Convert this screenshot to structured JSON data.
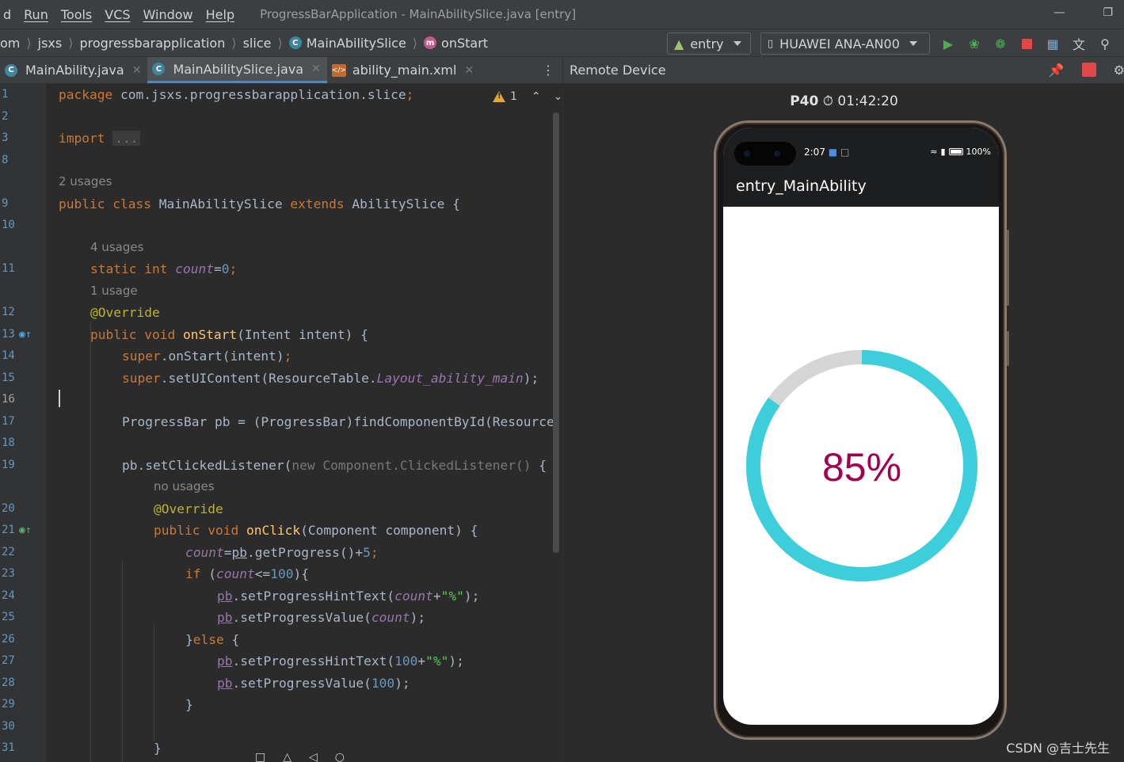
{
  "menubar": {
    "items": [
      "d",
      "Run",
      "Tools",
      "VCS",
      "Window",
      "Help"
    ],
    "title": "ProgressBarApplication - MainAbilitySlice.java [entry]"
  },
  "breadcrumb": {
    "items": [
      "om",
      "jsxs",
      "progressbarapplication",
      "slice",
      "MainAbilitySlice",
      "onStart"
    ]
  },
  "toolbar": {
    "module": "entry",
    "device": "HUAWEI ANA-AN00"
  },
  "tabs": [
    {
      "label": "MainAbility.java",
      "icon": "class-icon"
    },
    {
      "label": "MainAbilitySlice.java",
      "icon": "class-icon"
    },
    {
      "label": "ability_main.xml",
      "icon": "xml-icon"
    }
  ],
  "editor": {
    "warning_count": "1",
    "line_numbers": [
      "1",
      "2",
      "3",
      "8",
      "",
      "9",
      "10",
      "",
      "11",
      "",
      "12",
      "13",
      "14",
      "15",
      "16",
      "17",
      "18",
      "19",
      "",
      "20",
      "21",
      "22",
      "23",
      "24",
      "25",
      "26",
      "27",
      "28",
      "29",
      "30",
      "31"
    ],
    "current_line": "16",
    "code": {
      "l1_kw": "package",
      "l1_rest": " com.jsxs.progressbarapplication.slice",
      "l1_semi": ";",
      "l3_kw": "import",
      "l3_fold": "...",
      "usages_class": "2 usages",
      "l9_a": "public class",
      "l9_b": " MainAbilitySlice ",
      "l9_c": "extends",
      "l9_d": " AbilitySlice {",
      "usages_count": "4 usages",
      "l11_a": "static int",
      "l11_b": "count",
      "l11_c": "=",
      "l11_d": "0",
      "l11_e": ";",
      "usages_onstart": "1 usage",
      "l12_ann": "@Override",
      "l13_a": "public void",
      "l13_b": "onStart",
      "l13_c": "(Intent intent) {",
      "l14_a": "super",
      "l14_b": ".onStart(intent)",
      "l14_c": ";",
      "l15_a": "super",
      "l15_b": ".setUIContent(ResourceTable.",
      "l15_c": "Layout_ability_main",
      "l15_d": ");",
      "l17_a": "ProgressBar pb = (ProgressBar)findComponentById(Resource",
      "l19_a": "pb.setClickedListener(",
      "l19_b": "new Component.ClickedListener()",
      "l19_c": " {",
      "usages_onclick": "no usages",
      "l20_ann": "@Override",
      "l21_a": "public void",
      "l21_b": "onClick",
      "l21_c": "(Component component) {",
      "l22_a": "count",
      "l22_b": "=",
      "l22_c": "pb",
      "l22_d": ".getProgress()+",
      "l22_e": "5",
      "l22_f": ";",
      "l23_a": "if",
      "l23_b": " (",
      "l23_c": "count",
      "l23_d": "<=",
      "l23_e": "100",
      "l23_f": "){",
      "l24_a": "pb",
      "l24_b": ".setProgressHintText(",
      "l24_c": "count",
      "l24_d": "+",
      "l24_e": "\"%\"",
      "l24_f": ");",
      "l25_a": "pb",
      "l25_b": ".setProgressValue(",
      "l25_c": "count",
      "l25_d": ");",
      "l26_a": "}",
      "l26_b": "else",
      "l26_c": " {",
      "l27_a": "pb",
      "l27_b": ".setProgressHintText(",
      "l27_c": "100",
      "l27_d": "+",
      "l27_e": "\"%\"",
      "l27_f": ");",
      "l28_a": "pb",
      "l28_b": ".setProgressValue(",
      "l28_c": "100",
      "l28_d": ");",
      "l29": "}",
      "l31": "}"
    }
  },
  "remote": {
    "panel_title": "Remote Device",
    "device_model": "P40",
    "timer": "01:42:20",
    "status_time": "2:07",
    "battery": "100%",
    "app_title": "entry_MainAbility",
    "progress_text": "85%",
    "progress_value": 0.85,
    "progress_color": "#3ccfdb",
    "track_color": "#d5d5d5",
    "text_color": "#a3004f"
  },
  "watermark": "CSDN @吉士先生"
}
